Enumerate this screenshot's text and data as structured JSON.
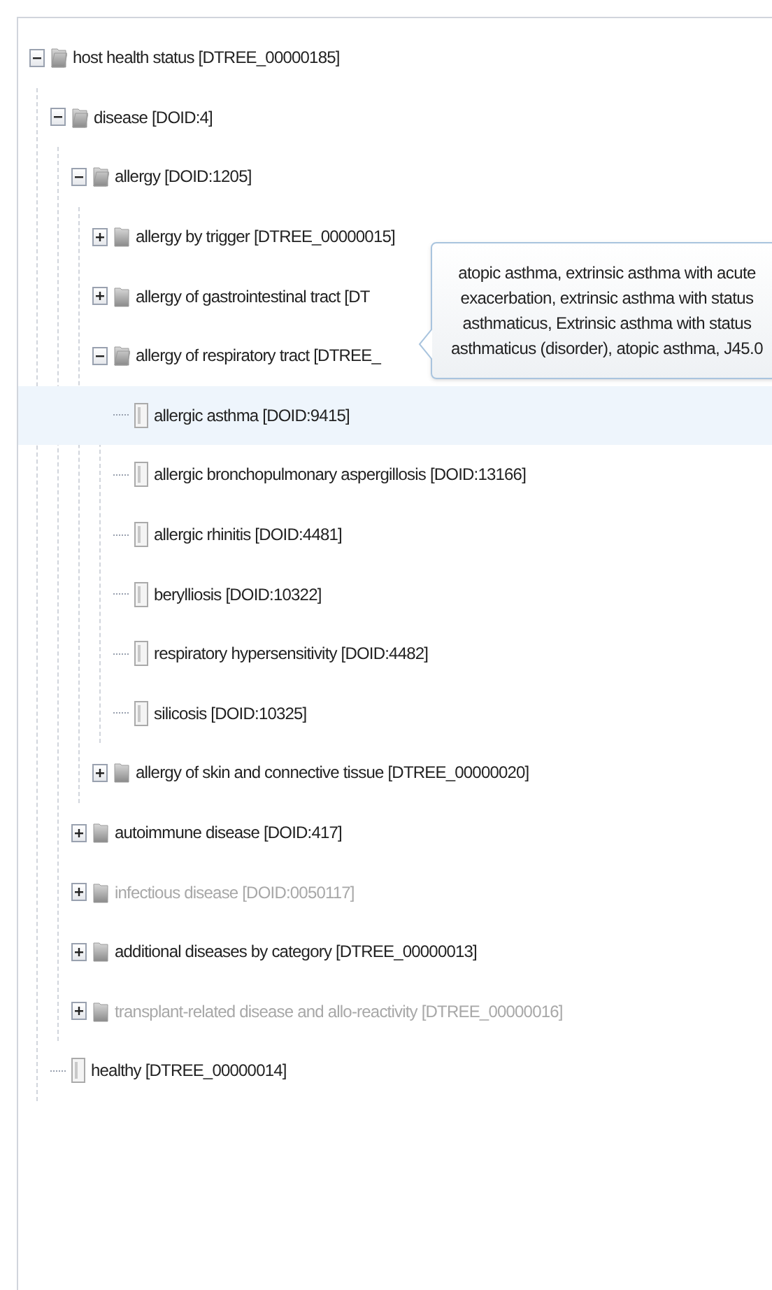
{
  "tree": [
    {
      "kind": "folder",
      "label": "host health status [DTREE_00000185]",
      "expanded": true,
      "disabled": false,
      "highlighted": false,
      "children": [
        {
          "kind": "folder",
          "label": "disease [DOID:4]",
          "expanded": true,
          "disabled": false,
          "highlighted": false,
          "children": [
            {
              "kind": "folder",
              "label": "allergy [DOID:1205]",
              "expanded": true,
              "disabled": false,
              "highlighted": false,
              "children": [
                {
                  "kind": "folder",
                  "label": "allergy by trigger [DTREE_00000015]",
                  "expanded": false,
                  "disabled": false,
                  "highlighted": false
                },
                {
                  "kind": "folder",
                  "label": "allergy of gastrointestinal tract [DT",
                  "expanded": false,
                  "disabled": false,
                  "highlighted": false
                },
                {
                  "kind": "folder",
                  "label": "allergy of respiratory tract [DTREE_",
                  "expanded": true,
                  "disabled": false,
                  "highlighted": false,
                  "children": [
                    {
                      "kind": "leaf",
                      "label": "allergic asthma [DOID:9415]",
                      "disabled": false,
                      "highlighted": true
                    },
                    {
                      "kind": "leaf",
                      "label": "allergic bronchopulmonary aspergillosis [DOID:13166]",
                      "disabled": false,
                      "highlighted": false
                    },
                    {
                      "kind": "leaf",
                      "label": "allergic rhinitis [DOID:4481]",
                      "disabled": false,
                      "highlighted": false
                    },
                    {
                      "kind": "leaf",
                      "label": "berylliosis [DOID:10322]",
                      "disabled": false,
                      "highlighted": false
                    },
                    {
                      "kind": "leaf",
                      "label": "respiratory hypersensitivity [DOID:4482]",
                      "disabled": false,
                      "highlighted": false
                    },
                    {
                      "kind": "leaf",
                      "label": "silicosis [DOID:10325]",
                      "disabled": false,
                      "highlighted": false
                    }
                  ]
                },
                {
                  "kind": "folder",
                  "label": "allergy of skin and connective tissue [DTREE_00000020]",
                  "expanded": false,
                  "disabled": false,
                  "highlighted": false
                }
              ]
            },
            {
              "kind": "folder",
              "label": "autoimmune disease [DOID:417]",
              "expanded": false,
              "disabled": false,
              "highlighted": false
            },
            {
              "kind": "folder",
              "label": "infectious disease [DOID:0050117]",
              "expanded": false,
              "disabled": true,
              "highlighted": false
            },
            {
              "kind": "folder",
              "label": "additional diseases by category [DTREE_00000013]",
              "expanded": false,
              "disabled": false,
              "highlighted": false
            },
            {
              "kind": "folder",
              "label": "transplant-related disease and allo-reactivity [DTREE_00000016]",
              "expanded": false,
              "disabled": true,
              "highlighted": false
            }
          ]
        },
        {
          "kind": "leaf",
          "label": "healthy [DTREE_00000014]",
          "disabled": false,
          "highlighted": false
        }
      ]
    }
  ],
  "tooltip": {
    "text": "atopic asthma, extrinsic asthma with acute exacerbation, extrinsic asthma with status asthmaticus, Extrinsic asthma with status asthmaticus (disorder), atopic asthma, J45.0"
  }
}
